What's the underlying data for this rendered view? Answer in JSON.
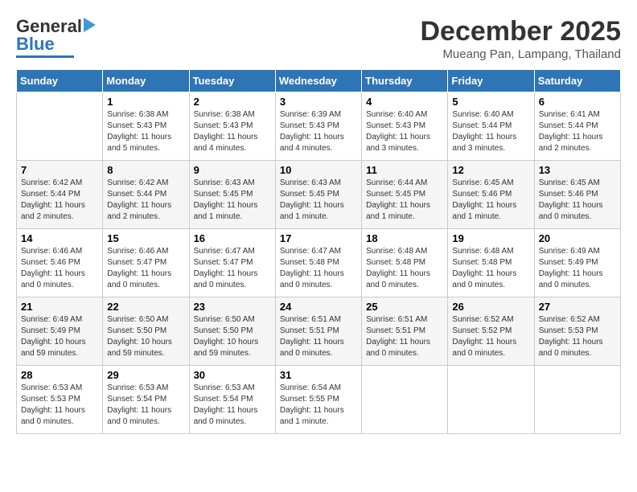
{
  "logo": {
    "line1": "General",
    "line2": "Blue"
  },
  "header": {
    "month": "December 2025",
    "location": "Mueang Pan, Lampang, Thailand"
  },
  "weekdays": [
    "Sunday",
    "Monday",
    "Tuesday",
    "Wednesday",
    "Thursday",
    "Friday",
    "Saturday"
  ],
  "weeks": [
    [
      {
        "day": null
      },
      {
        "day": "1",
        "sunrise": "6:38 AM",
        "sunset": "5:43 PM",
        "daylight": "11 hours and 5 minutes."
      },
      {
        "day": "2",
        "sunrise": "6:38 AM",
        "sunset": "5:43 PM",
        "daylight": "11 hours and 4 minutes."
      },
      {
        "day": "3",
        "sunrise": "6:39 AM",
        "sunset": "5:43 PM",
        "daylight": "11 hours and 4 minutes."
      },
      {
        "day": "4",
        "sunrise": "6:40 AM",
        "sunset": "5:43 PM",
        "daylight": "11 hours and 3 minutes."
      },
      {
        "day": "5",
        "sunrise": "6:40 AM",
        "sunset": "5:44 PM",
        "daylight": "11 hours and 3 minutes."
      },
      {
        "day": "6",
        "sunrise": "6:41 AM",
        "sunset": "5:44 PM",
        "daylight": "11 hours and 2 minutes."
      }
    ],
    [
      {
        "day": "7",
        "sunrise": "6:42 AM",
        "sunset": "5:44 PM",
        "daylight": "11 hours and 2 minutes."
      },
      {
        "day": "8",
        "sunrise": "6:42 AM",
        "sunset": "5:44 PM",
        "daylight": "11 hours and 2 minutes."
      },
      {
        "day": "9",
        "sunrise": "6:43 AM",
        "sunset": "5:45 PM",
        "daylight": "11 hours and 1 minute."
      },
      {
        "day": "10",
        "sunrise": "6:43 AM",
        "sunset": "5:45 PM",
        "daylight": "11 hours and 1 minute."
      },
      {
        "day": "11",
        "sunrise": "6:44 AM",
        "sunset": "5:45 PM",
        "daylight": "11 hours and 1 minute."
      },
      {
        "day": "12",
        "sunrise": "6:45 AM",
        "sunset": "5:46 PM",
        "daylight": "11 hours and 1 minute."
      },
      {
        "day": "13",
        "sunrise": "6:45 AM",
        "sunset": "5:46 PM",
        "daylight": "11 hours and 0 minutes."
      }
    ],
    [
      {
        "day": "14",
        "sunrise": "6:46 AM",
        "sunset": "5:46 PM",
        "daylight": "11 hours and 0 minutes."
      },
      {
        "day": "15",
        "sunrise": "6:46 AM",
        "sunset": "5:47 PM",
        "daylight": "11 hours and 0 minutes."
      },
      {
        "day": "16",
        "sunrise": "6:47 AM",
        "sunset": "5:47 PM",
        "daylight": "11 hours and 0 minutes."
      },
      {
        "day": "17",
        "sunrise": "6:47 AM",
        "sunset": "5:48 PM",
        "daylight": "11 hours and 0 minutes."
      },
      {
        "day": "18",
        "sunrise": "6:48 AM",
        "sunset": "5:48 PM",
        "daylight": "11 hours and 0 minutes."
      },
      {
        "day": "19",
        "sunrise": "6:48 AM",
        "sunset": "5:48 PM",
        "daylight": "11 hours and 0 minutes."
      },
      {
        "day": "20",
        "sunrise": "6:49 AM",
        "sunset": "5:49 PM",
        "daylight": "11 hours and 0 minutes."
      }
    ],
    [
      {
        "day": "21",
        "sunrise": "6:49 AM",
        "sunset": "5:49 PM",
        "daylight": "10 hours and 59 minutes."
      },
      {
        "day": "22",
        "sunrise": "6:50 AM",
        "sunset": "5:50 PM",
        "daylight": "10 hours and 59 minutes."
      },
      {
        "day": "23",
        "sunrise": "6:50 AM",
        "sunset": "5:50 PM",
        "daylight": "10 hours and 59 minutes."
      },
      {
        "day": "24",
        "sunrise": "6:51 AM",
        "sunset": "5:51 PM",
        "daylight": "11 hours and 0 minutes."
      },
      {
        "day": "25",
        "sunrise": "6:51 AM",
        "sunset": "5:51 PM",
        "daylight": "11 hours and 0 minutes."
      },
      {
        "day": "26",
        "sunrise": "6:52 AM",
        "sunset": "5:52 PM",
        "daylight": "11 hours and 0 minutes."
      },
      {
        "day": "27",
        "sunrise": "6:52 AM",
        "sunset": "5:53 PM",
        "daylight": "11 hours and 0 minutes."
      }
    ],
    [
      {
        "day": "28",
        "sunrise": "6:53 AM",
        "sunset": "5:53 PM",
        "daylight": "11 hours and 0 minutes."
      },
      {
        "day": "29",
        "sunrise": "6:53 AM",
        "sunset": "5:54 PM",
        "daylight": "11 hours and 0 minutes."
      },
      {
        "day": "30",
        "sunrise": "6:53 AM",
        "sunset": "5:54 PM",
        "daylight": "11 hours and 0 minutes."
      },
      {
        "day": "31",
        "sunrise": "6:54 AM",
        "sunset": "5:55 PM",
        "daylight": "11 hours and 1 minute."
      },
      {
        "day": null
      },
      {
        "day": null
      },
      {
        "day": null
      }
    ]
  ]
}
